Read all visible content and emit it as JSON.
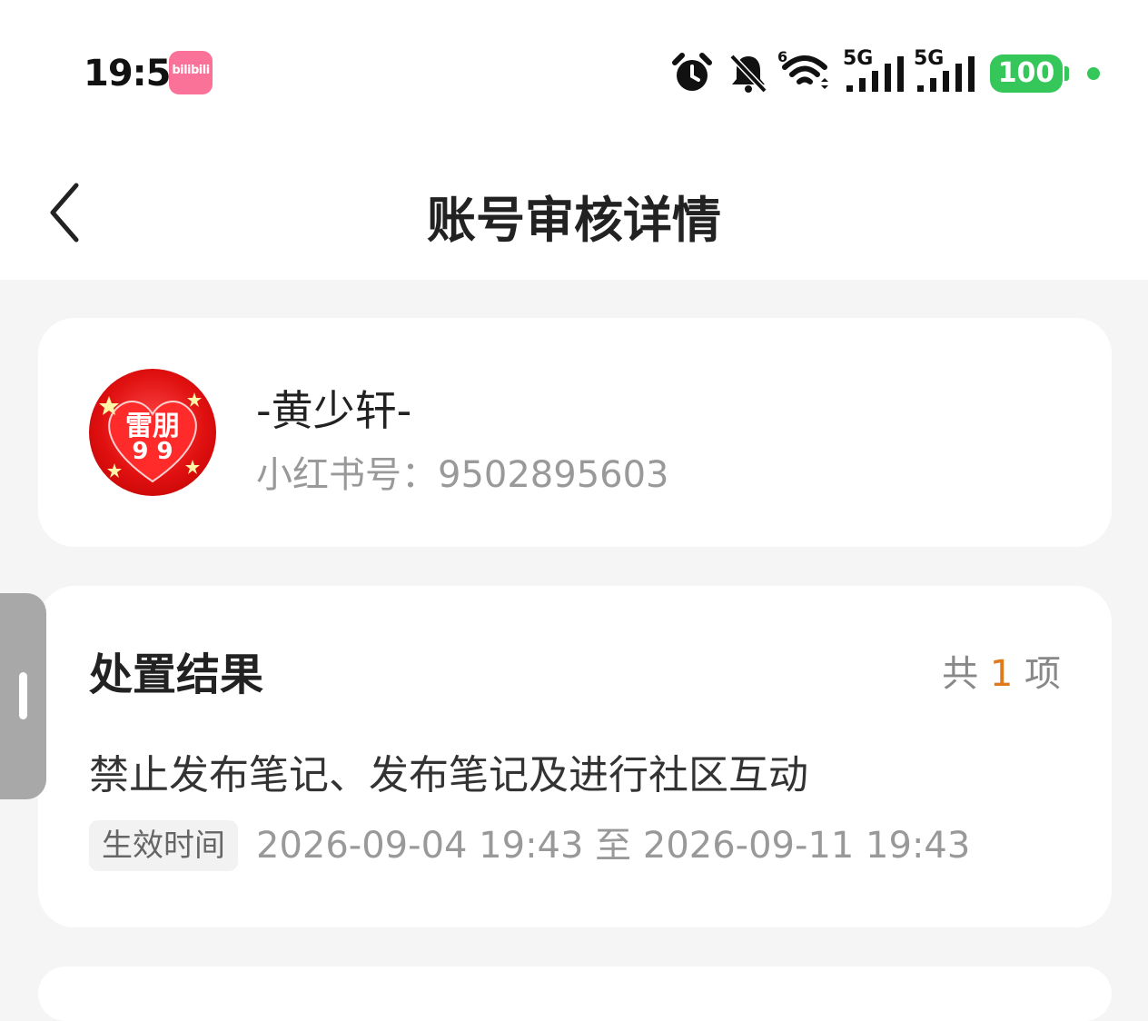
{
  "status_bar": {
    "time": "19:53",
    "app_badge": "bilibili",
    "signal_1_label": "5G",
    "signal_2_label": "5G",
    "wifi_label": "6",
    "battery": "100",
    "icons": [
      "alarm-icon",
      "bell-muted-icon",
      "wifi-icon",
      "signal-icon",
      "signal-icon",
      "battery-icon"
    ],
    "battery_color": "#35c759"
  },
  "nav": {
    "title": "账号审核详情"
  },
  "profile": {
    "name": "-黄少轩-",
    "id_text": "小红书号：9502895603",
    "avatar_text_1": "雷朋",
    "avatar_text_2": "9 9"
  },
  "result": {
    "section_title": "处置结果",
    "count_prefix": "共",
    "count": "1",
    "count_suffix": "项",
    "action": "禁止发布笔记、发布笔记及进行社区互动",
    "tag_label": "生效时间",
    "period": "2026-09-04 19:43 至 2026-09-11 19:43",
    "accent_color": "#e07a1f"
  }
}
